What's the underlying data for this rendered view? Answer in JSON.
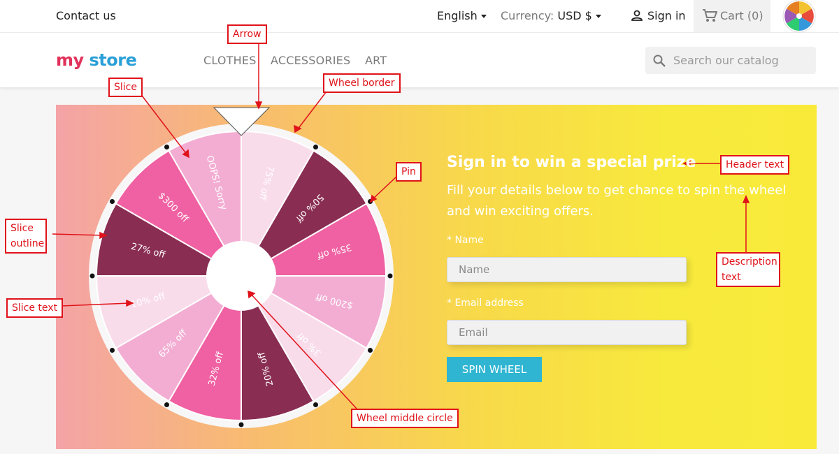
{
  "topbar": {
    "contact": "Contact us",
    "language": "English",
    "currency_label": "Currency:",
    "currency_value": "USD $",
    "sign_in": "Sign in",
    "cart": "Cart (0)"
  },
  "header": {
    "logo_left": "my",
    "logo_right": "store",
    "nav": [
      "CLOTHES",
      "ACCESSORIES",
      "ART"
    ],
    "search_placeholder": "Search our catalog"
  },
  "wheel": {
    "slices": [
      {
        "label": "75% off",
        "color": "#f9dcea"
      },
      {
        "label": "50% off",
        "color": "#892e52"
      },
      {
        "label": "35% off",
        "color": "#ef61a2"
      },
      {
        "label": "$200 off",
        "color": "#f3add3"
      },
      {
        "label": "3% off",
        "color": "#f9dcea"
      },
      {
        "label": "20% off",
        "color": "#892e52"
      },
      {
        "label": "32% off",
        "color": "#ef61a2"
      },
      {
        "label": "65% off",
        "color": "#f3add3"
      },
      {
        "label": "10% off",
        "color": "#f9dcea"
      },
      {
        "label": "27% off",
        "color": "#892e52"
      },
      {
        "label": "$300 off",
        "color": "#ef61a2"
      },
      {
        "label": "OOPS! Sorry",
        "color": "#f3add3"
      }
    ]
  },
  "form": {
    "title": "Sign in to win a special prize",
    "description": "Fill your details below to get chance to spin the wheel and win exciting offers.",
    "name_label": "* Name",
    "name_placeholder": "Name",
    "email_label": "* Email address",
    "email_placeholder": "Email",
    "spin_button": "SPIN WHEEL"
  },
  "annotations": {
    "arrow": "Arrow",
    "slice": "Slice",
    "wheel_border": "Wheel border",
    "pin": "Pin",
    "header_text": "Header text",
    "slice_outline_1": "Slice",
    "slice_outline_2": "outline",
    "description_1": "Description",
    "description_2": "text",
    "slice_text": "Slice text",
    "wheel_middle_circle": "Wheel middle circle"
  },
  "colors": {
    "accent": "#2fb5d2",
    "annotation": "#e0121a"
  }
}
